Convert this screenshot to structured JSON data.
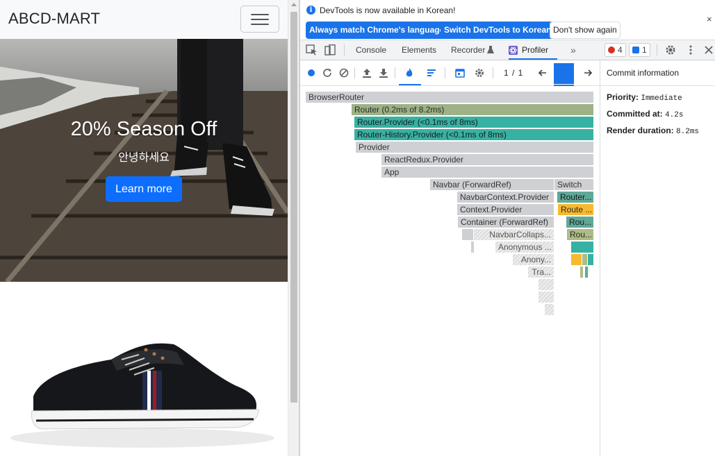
{
  "site": {
    "brand": "ABCD-MART",
    "hero": {
      "title": "20% Season Off",
      "subtitle": "안녕하세요",
      "button": "Learn more"
    }
  },
  "devtools": {
    "infobar": {
      "message": "DevTools is now available in Korean!",
      "buttons": [
        "Always match Chrome's language",
        "Switch DevTools to Korean",
        "Don't show again"
      ],
      "close": "×"
    },
    "tabs": [
      {
        "label": "Console",
        "active": false
      },
      {
        "label": "Elements",
        "active": false
      },
      {
        "label": "Recorder",
        "active": false
      },
      {
        "label": "Profiler",
        "active": true
      }
    ],
    "more_tabs": "»",
    "errors_count": "4",
    "messages_count": "1",
    "profiler": {
      "commit_nav": "1 / 1",
      "commit_info_title": "Commit information",
      "priority_label": "Priority:",
      "priority_value": "Immediate",
      "committed_label": "Committed at:",
      "committed_value": "4.2s",
      "render_label": "Render duration:",
      "render_value": "8.2ms"
    },
    "flame": [
      {
        "label": "BrowserRouter",
        "color": "gray"
      },
      {
        "label": "Router (0.2ms of 8.2ms)",
        "color": "green"
      },
      {
        "label": "Router.Provider (<0.1ms of 8ms)",
        "color": "teal"
      },
      {
        "label": "Router-History.Provider (<0.1ms of 8ms)",
        "color": "teal"
      },
      {
        "label": "Provider",
        "color": "gray"
      },
      {
        "label": "ReactRedux.Provider",
        "color": "gray"
      },
      {
        "label": "App",
        "color": "gray"
      },
      {
        "label": "Navbar (ForwardRef)",
        "color": "gray"
      },
      {
        "label": "Switch",
        "color": "gray"
      },
      {
        "label": "NavbarContext.Provider",
        "color": "gray"
      },
      {
        "label": "Router...",
        "color": "teal2"
      },
      {
        "label": "Context.Provider",
        "color": "gray"
      },
      {
        "label": "Route ...",
        "color": "yellow"
      },
      {
        "label": "Container (ForwardRef)",
        "color": "gray"
      },
      {
        "label": "Rou...",
        "color": "teal2"
      },
      {
        "label": "NavbarCollaps...",
        "color": "hatch"
      },
      {
        "label": "Rou...",
        "color": "olive"
      },
      {
        "label": "Anonymous ...",
        "color": "hatch"
      },
      {
        "label": "Anony...",
        "color": "hatch"
      },
      {
        "label": "Tra...",
        "color": "hatch"
      }
    ]
  }
}
